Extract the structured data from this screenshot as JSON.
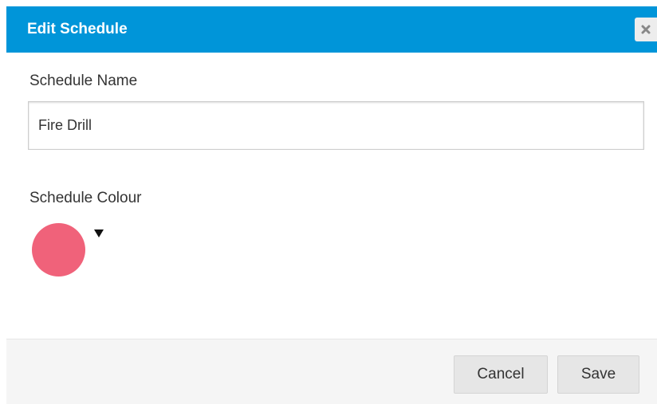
{
  "dialog": {
    "title": "Edit Schedule",
    "close_icon": "close-icon"
  },
  "form": {
    "name_label": "Schedule Name",
    "name_value": "Fire Drill",
    "colour_label": "Schedule Colour",
    "colour_value": "#f0627a",
    "colour_caret_icon": "caret-down-icon"
  },
  "footer": {
    "cancel_label": "Cancel",
    "save_label": "Save"
  },
  "colors": {
    "header": "#0095d9",
    "footer": "#f5f5f5"
  }
}
